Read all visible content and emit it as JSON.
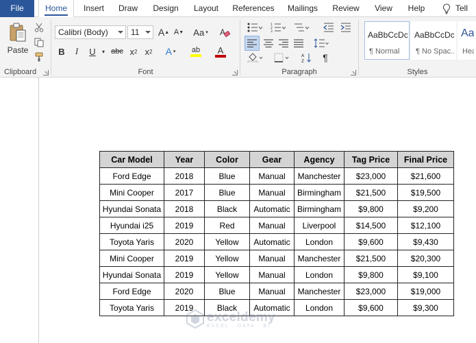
{
  "tabs": [
    {
      "label": "File"
    },
    {
      "label": "Home"
    },
    {
      "label": "Insert"
    },
    {
      "label": "Draw"
    },
    {
      "label": "Design"
    },
    {
      "label": "Layout"
    },
    {
      "label": "References"
    },
    {
      "label": "Mailings"
    },
    {
      "label": "Review"
    },
    {
      "label": "View"
    },
    {
      "label": "Help"
    },
    {
      "label": "Tell m"
    }
  ],
  "active_tab": "Home",
  "ribbon": {
    "clipboard": {
      "label": "Clipboard",
      "paste_label": "Paste"
    },
    "font": {
      "label": "Font",
      "font_name": "Calibri (Body)",
      "font_size": "11",
      "bold": "B",
      "italic": "I",
      "underline": "U",
      "strike": "abc",
      "subscript": "x",
      "superscript": "x",
      "grow": "A",
      "shrink": "A",
      "change_case": "Aa",
      "text_effects": "A",
      "highlight": "ab",
      "font_color": "A"
    },
    "paragraph": {
      "label": "Paragraph",
      "pilcrow": "¶"
    },
    "styles": {
      "label": "Styles",
      "items": [
        {
          "sample": "AaBbCcDc",
          "name": "¶ Normal"
        },
        {
          "sample": "AaBbCcDc",
          "name": "¶ No Spac..."
        },
        {
          "sample": "AaB",
          "name": "Hea"
        }
      ]
    }
  },
  "table": {
    "headers": [
      "Car Model",
      "Year",
      "Color",
      "Gear",
      "Agency",
      "Tag Price",
      "Final Price"
    ],
    "rows": [
      [
        "Ford Edge",
        "2018",
        "Blue",
        "Manual",
        "Manchester",
        "$23,000",
        "$21,600"
      ],
      [
        "Mini Cooper",
        "2017",
        "Blue",
        "Manual",
        "Birmingham",
        "$21,500",
        "$19,500"
      ],
      [
        "Hyundai Sonata",
        "2018",
        "Black",
        "Automatic",
        "Birmingham",
        "$9,800",
        "$9,200"
      ],
      [
        "Hyundai i25",
        "2019",
        "Red",
        "Manual",
        "Liverpool",
        "$14,500",
        "$12,100"
      ],
      [
        "Toyota Yaris",
        "2020",
        "Yellow",
        "Automatic",
        "London",
        "$9,600",
        "$9,430"
      ],
      [
        "Mini Cooper",
        "2019",
        "Yellow",
        "Manual",
        "Manchester",
        "$21,500",
        "$20,300"
      ],
      [
        "Hyundai Sonata",
        "2019",
        "Yellow",
        "Manual",
        "London",
        "$9,800",
        "$9,100"
      ],
      [
        "Ford Edge",
        "2020",
        "Blue",
        "Manual",
        "Manchester",
        "$23,000",
        "$19,000"
      ],
      [
        "Toyota Yaris",
        "2019",
        "Black",
        "Automatic",
        "London",
        "$9,600",
        "$9,300"
      ]
    ]
  },
  "watermark": {
    "name": "exceldemy",
    "tagline": "EXCEL · DATA · BI"
  },
  "colors": {
    "file_tab": "#2b579a",
    "header_fill": "#d4d4d4",
    "highlight": "#ffff00",
    "font_color": "#c00000"
  }
}
